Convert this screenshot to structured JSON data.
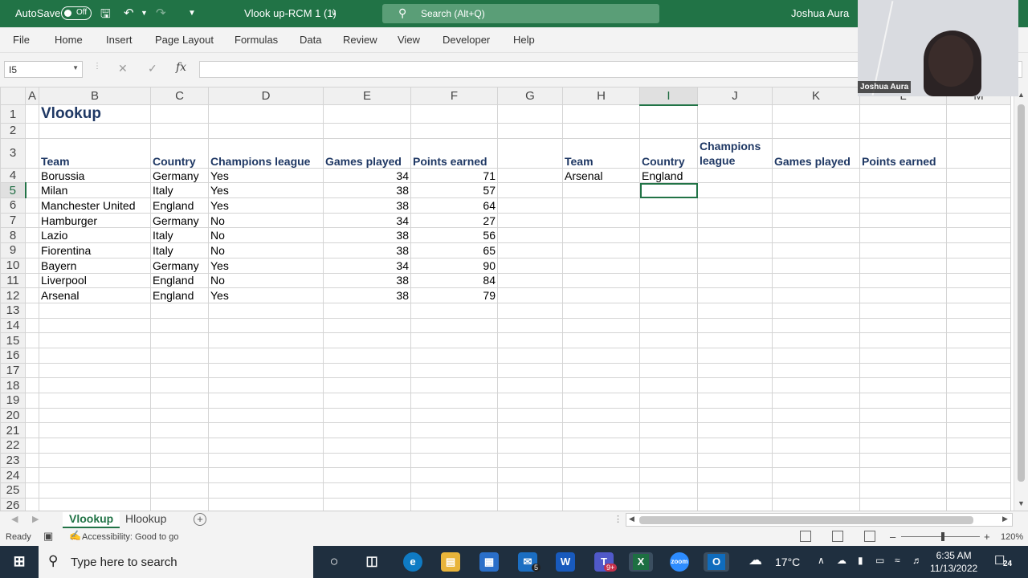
{
  "titlebar": {
    "autosave_label": "AutoSave",
    "autosave_state": "Off",
    "doc_title": "Vlook up-RCM 1 (1)",
    "search_placeholder": "Search (Alt+Q)",
    "user_name": "Joshua Aura"
  },
  "menu": [
    "File",
    "Home",
    "Insert",
    "Page Layout",
    "Formulas",
    "Data",
    "Review",
    "View",
    "Developer",
    "Help"
  ],
  "formula_bar": {
    "name_box": "I5",
    "fx_label": "fx",
    "content": ""
  },
  "columns": [
    "A",
    "B",
    "C",
    "D",
    "E",
    "F",
    "G",
    "H",
    "I",
    "J",
    "K",
    "L",
    "M"
  ],
  "selected_column": "I",
  "selected_row": 5,
  "rows": [
    {
      "n": "1",
      "cells": {
        "B": "Vlookup"
      }
    },
    {
      "n": "2",
      "cells": {}
    },
    {
      "n": "3",
      "cells": {
        "B": "Team",
        "C": "Country",
        "D": "Champions league",
        "E": "Games played",
        "F": "Points earned",
        "H": "Team",
        "I": "Country",
        "J": "Champions league",
        "K": "Games played",
        "L": "Points earned"
      }
    },
    {
      "n": "4",
      "cells": {
        "B": "Borussia",
        "C": "Germany",
        "D": "Yes",
        "E": "34",
        "F": "71",
        "H": "Arsenal",
        "I": "England"
      }
    },
    {
      "n": "5",
      "cells": {
        "B": "Milan",
        "C": "Italy",
        "D": "Yes",
        "E": "38",
        "F": "57"
      }
    },
    {
      "n": "6",
      "cells": {
        "B": "Manchester United",
        "C": "England",
        "D": "Yes",
        "E": "38",
        "F": "64"
      }
    },
    {
      "n": "7",
      "cells": {
        "B": "Hamburger",
        "C": "Germany",
        "D": "No",
        "E": "34",
        "F": "27"
      }
    },
    {
      "n": "8",
      "cells": {
        "B": "Lazio",
        "C": "Italy",
        "D": "No",
        "E": "38",
        "F": "56"
      }
    },
    {
      "n": "9",
      "cells": {
        "B": "Fiorentina",
        "C": "Italy",
        "D": "No",
        "E": "38",
        "F": "65"
      }
    },
    {
      "n": "10",
      "cells": {
        "B": "Bayern",
        "C": "Germany",
        "D": "Yes",
        "E": "34",
        "F": "90"
      }
    },
    {
      "n": "11",
      "cells": {
        "B": "Liverpool",
        "C": "England",
        "D": "No",
        "E": "38",
        "F": "84"
      }
    },
    {
      "n": "12",
      "cells": {
        "B": "Arsenal",
        "C": "England",
        "D": "Yes",
        "E": "38",
        "F": "79"
      }
    },
    {
      "n": "13",
      "cells": {}
    },
    {
      "n": "14",
      "cells": {}
    },
    {
      "n": "15",
      "cells": {}
    },
    {
      "n": "16",
      "cells": {}
    },
    {
      "n": "17",
      "cells": {}
    },
    {
      "n": "18",
      "cells": {}
    },
    {
      "n": "19",
      "cells": {}
    },
    {
      "n": "20",
      "cells": {}
    },
    {
      "n": "21",
      "cells": {}
    },
    {
      "n": "22",
      "cells": {}
    },
    {
      "n": "23",
      "cells": {}
    },
    {
      "n": "24",
      "cells": {}
    },
    {
      "n": "25",
      "cells": {}
    },
    {
      "n": "26",
      "cells": {}
    }
  ],
  "sheets": [
    "Vlookup",
    "Hlookup"
  ],
  "active_sheet": "Vlookup",
  "status": {
    "ready": "Ready",
    "accessibility": "Accessibility: Good to go",
    "zoom": "120%"
  },
  "webcam": {
    "name": "Joshua Aura"
  },
  "taskbar": {
    "search_placeholder": "Type here to search",
    "mail_badge": "5",
    "teams_badge": "9+",
    "weather": "17°C",
    "time": "6:35 AM",
    "date": "11/13/2022",
    "notifications": "24"
  },
  "colors": {
    "excel_green": "#217346",
    "header_text": "#1f3864",
    "taskbar": "#1f2f3f"
  }
}
